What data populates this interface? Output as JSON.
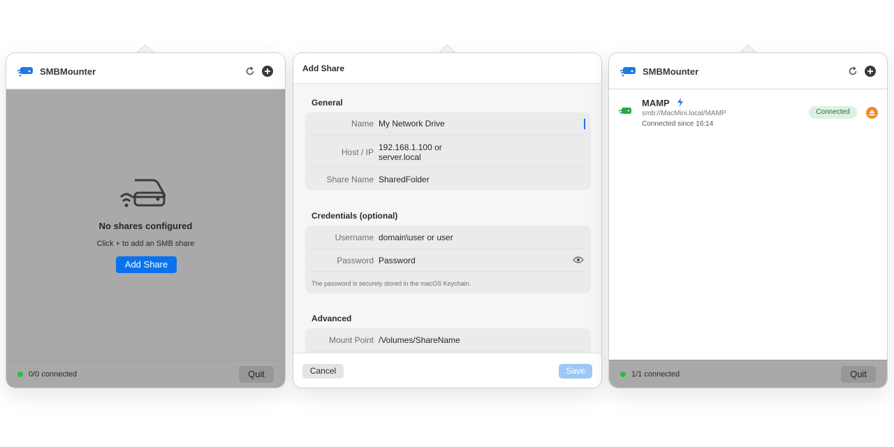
{
  "colors": {
    "accent": "#0a72ee",
    "connected": "#27c13f",
    "eject": "#f08c25"
  },
  "empty_window": {
    "title": "SMBMounter",
    "empty_title": "No shares configured",
    "empty_subtitle": "Click + to add an SMB share",
    "add_button": "Add Share",
    "status": "0/0 connected",
    "quit": "Quit"
  },
  "add_share": {
    "title": "Add Share",
    "general": {
      "heading": "General",
      "name_label": "Name",
      "name_value": "My Network Drive",
      "host_label": "Host / IP",
      "host_value_1": "192.168.1.100 or",
      "host_value_2": "server.local",
      "share_label": "Share Name",
      "share_value": "SharedFolder"
    },
    "credentials": {
      "heading": "Credentials (optional)",
      "username_label": "Username",
      "username_value": "domain\\user or user",
      "password_label": "Password",
      "password_value": "Password",
      "note": "The password is securely stored in the macOS Keychain."
    },
    "advanced": {
      "heading": "Advanced",
      "mount_label": "Mount Point",
      "mount_value": "/Volumes/ShareName"
    },
    "cancel": "Cancel",
    "save": "Save"
  },
  "connected_window": {
    "title": "SMBMounter",
    "share": {
      "name": "MAMP",
      "url": "smb://MacMini.local/MAMP",
      "since": "Connected since 16:14",
      "badge": "Connected"
    },
    "status": "1/1 connected",
    "quit": "Quit"
  }
}
